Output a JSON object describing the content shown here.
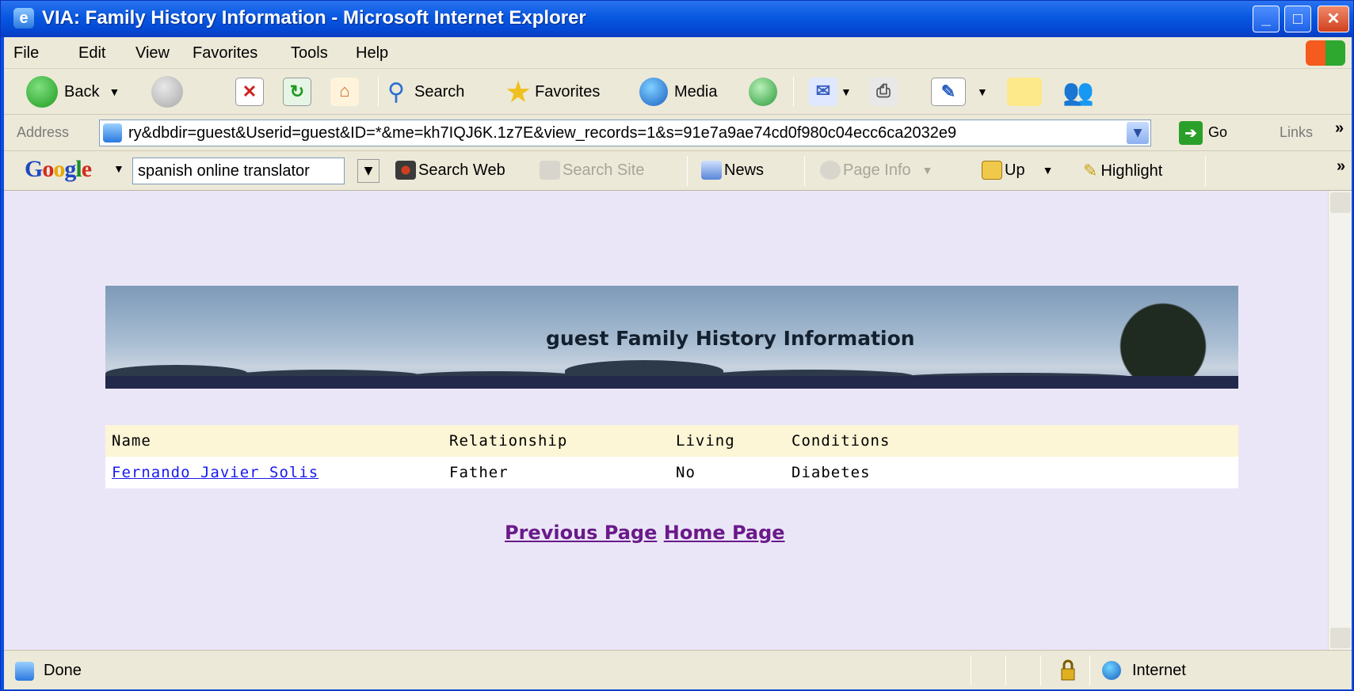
{
  "window": {
    "title": "VIA: Family History Information - Microsoft Internet Explorer",
    "title_icon": "ie-icon"
  },
  "menu": {
    "items": [
      "File",
      "Edit",
      "View",
      "Favorites",
      "Tools",
      "Help"
    ]
  },
  "toolbar": {
    "back_label": "Back",
    "search_label": "Search",
    "favorites_label": "Favorites",
    "media_label": "Media"
  },
  "address": {
    "label": "Address",
    "url": "ry&dbdir=guest&Userid=guest&ID=*&me=kh7IQJ6K.1z7E&view_records=1&s=91e7a9ae74cd0f980c04ecc6ca2032e9",
    "go_label": "Go",
    "links_label": "Links",
    "chevron": "»"
  },
  "google": {
    "search_value": "spanish online translator",
    "search_web": "Search Web",
    "search_site": "Search Site",
    "news": "News",
    "page_info": "Page Info",
    "up": "Up",
    "highlight": "Highlight",
    "chevron": "»"
  },
  "page": {
    "banner_title": "guest Family History Information",
    "table": {
      "headers": [
        "Name",
        "Relationship",
        "Living",
        "Conditions"
      ],
      "rows": [
        {
          "name": "Fernando Javier Solis",
          "relationship": "Father",
          "living": "No",
          "conditions": "Diabetes"
        }
      ]
    },
    "links": {
      "previous": "Previous Page",
      "home": "Home Page"
    }
  },
  "status": {
    "text": "Done",
    "zone": "Internet"
  },
  "colors": {
    "titlebar": "#0a4ee0",
    "chrome": "#ece9d8",
    "viewport": "#ebe6f7",
    "table_header": "#fcf5d6",
    "link": "#1a1aee",
    "visited_link": "#6a1a8a"
  }
}
